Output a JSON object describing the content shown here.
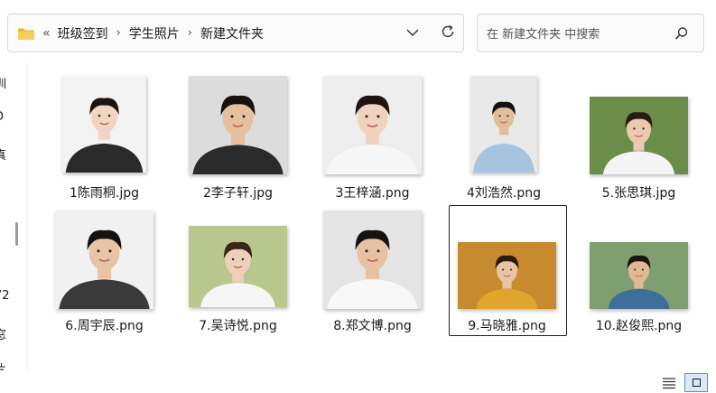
{
  "address_bar": {
    "overflow_glyph": "«",
    "breadcrumbs": [
      "班级签到",
      "学生照片",
      "新建文件夹"
    ],
    "separator": "›"
  },
  "search": {
    "placeholder": "在 新建文件夹 中搜索"
  },
  "nav_pane_fragments": [
    "训",
    "D",
    "真",
    "l",
    "72",
    "窓",
    "片"
  ],
  "files": [
    {
      "name": "1陈雨桐.jpg",
      "bg": "#f3f3f3",
      "shirt": "#2a2a2a",
      "hair": "#1b1410",
      "skin": "#f1d4c2"
    },
    {
      "name": "2李子轩.jpg",
      "bg": "#dcdcdc",
      "shirt": "#2b2b2b",
      "hair": "#171210",
      "skin": "#e6bf9f"
    },
    {
      "name": "3王梓涵.png",
      "bg": "#eeeeee",
      "shirt": "#f7f7f7",
      "hair": "#1c1511",
      "skin": "#f0d2bf"
    },
    {
      "name": "4刘浩然.png",
      "bg": "#e9e9e9",
      "shirt": "#a7c4de",
      "hair": "#151110",
      "skin": "#e3bc9b"
    },
    {
      "name": "5.张思琪.jpg",
      "bg": "#6b8d4a",
      "shirt": "#f4f4f4",
      "hair": "#2a1c14",
      "skin": "#ecc9ae"
    },
    {
      "name": "6.周宇辰.png",
      "bg": "#f1f1f1",
      "shirt": "#3a3a3a",
      "hair": "#161210",
      "skin": "#e8c3a4"
    },
    {
      "name": "7.吴诗悦.png",
      "bg": "#b7c78e",
      "shirt": "#f6f6f6",
      "hair": "#3a2619",
      "skin": "#f0cfb8"
    },
    {
      "name": "8.郑文博.png",
      "bg": "#e4e4e4",
      "shirt": "#f8f8f8",
      "hair": "#161210",
      "skin": "#e6c1a2"
    },
    {
      "name": "9.马晓雅.png",
      "bg": "#c88a2e",
      "shirt": "#e0a52c",
      "hair": "#2a1a12",
      "skin": "#e9c3a3"
    },
    {
      "name": "10.赵俊熙.png",
      "bg": "#7ea070",
      "shirt": "#3e6f98",
      "hair": "#1a1411",
      "skin": "#e2b995"
    }
  ],
  "selected_file": "9.马晓雅.png",
  "colors": {
    "accent": "#5a8fc8",
    "folder": "#f2c94c"
  }
}
